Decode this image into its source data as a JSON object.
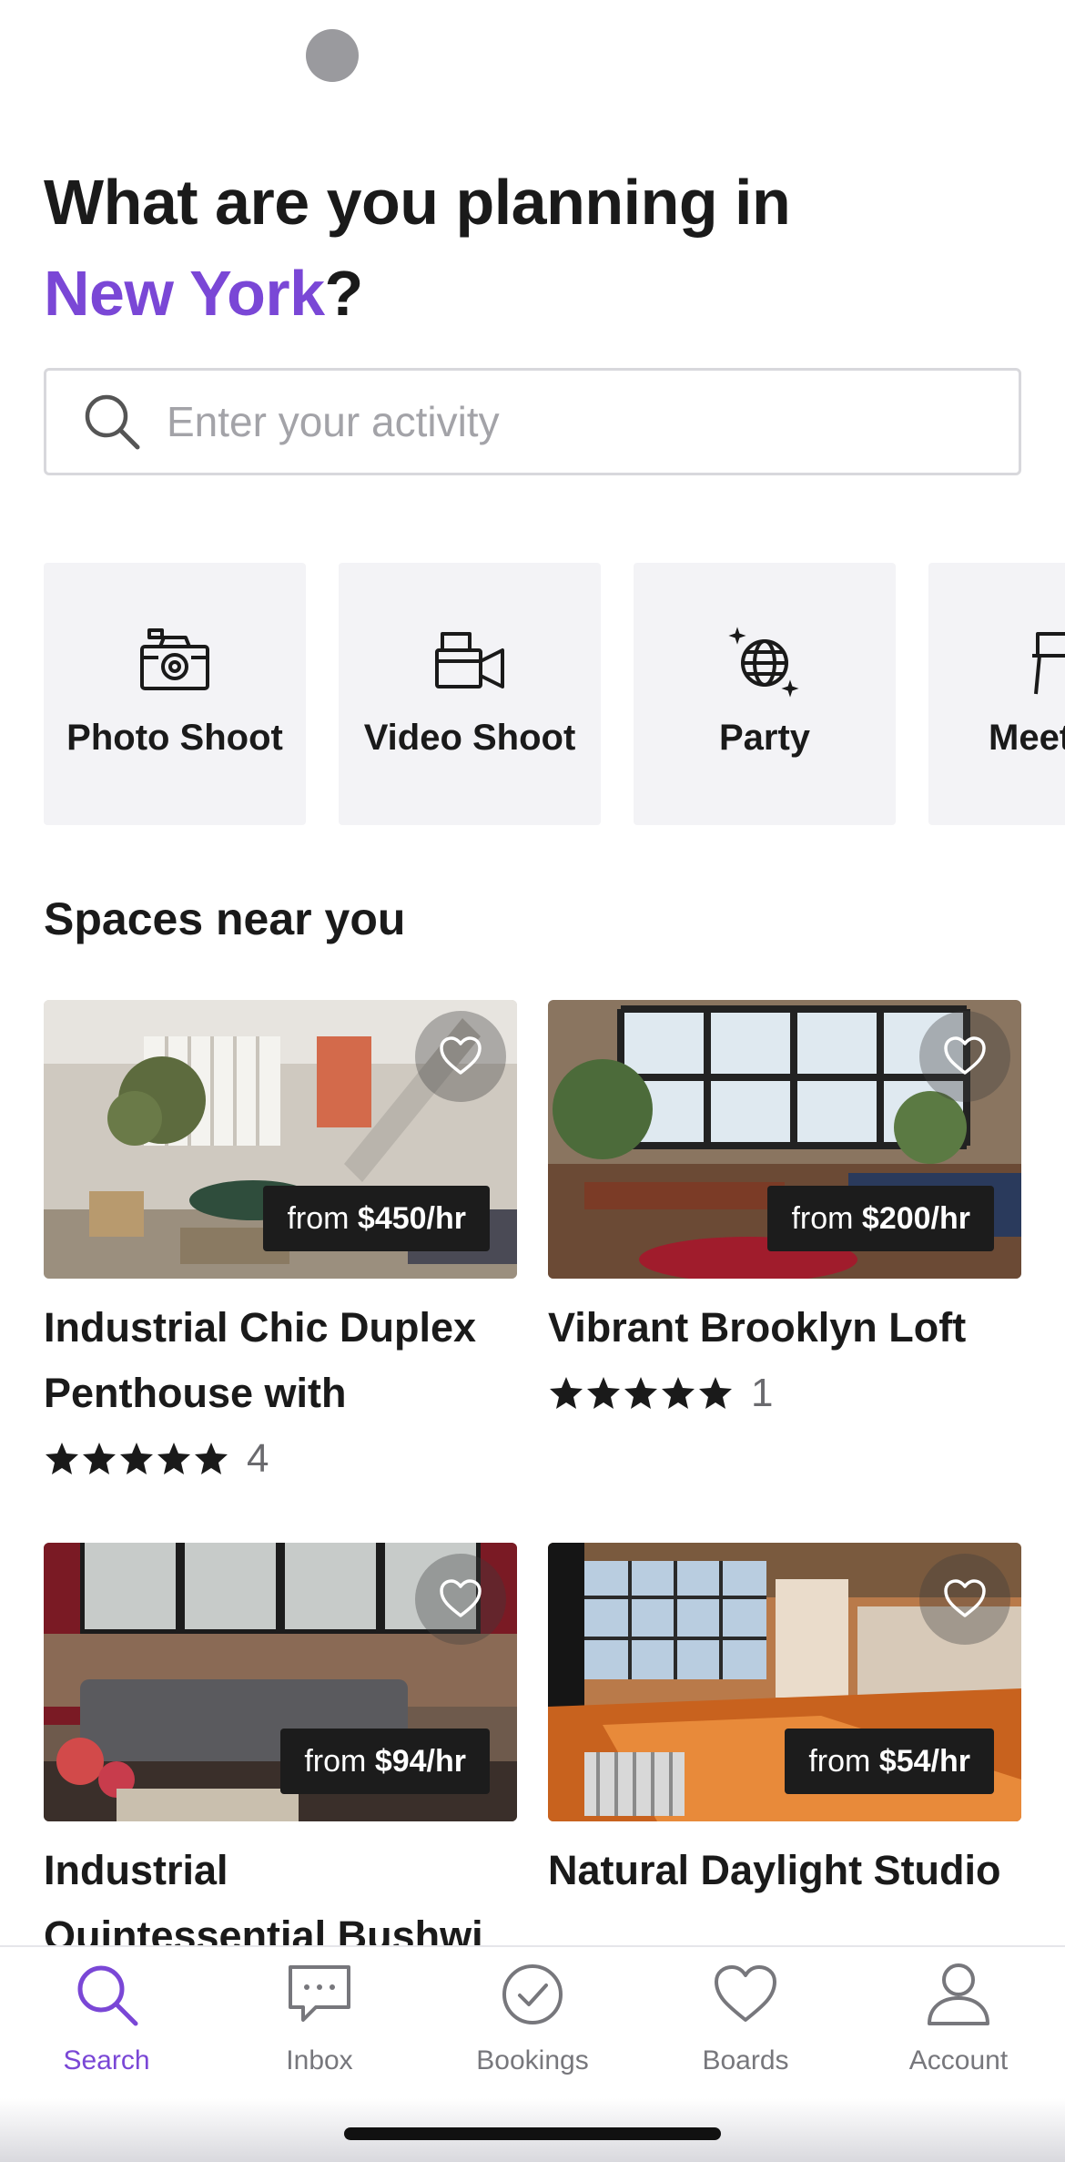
{
  "header": {
    "title_line1": "What are you planning in",
    "city": "New York",
    "title_suffix": "?"
  },
  "search": {
    "placeholder": "Enter your activity",
    "icon": "search-icon"
  },
  "categories": [
    {
      "label": "Photo Shoot",
      "icon": "camera-icon"
    },
    {
      "label": "Video Shoot",
      "icon": "video-camera-icon"
    },
    {
      "label": "Party",
      "icon": "disco-ball-icon"
    },
    {
      "label": "Meet",
      "icon": "chair-icon"
    }
  ],
  "section": {
    "title": "Spaces near you"
  },
  "listings": [
    {
      "title": "Industrial Chic Duplex Penthouse with Abund...",
      "price_prefix": "from ",
      "price": "$450/hr",
      "rating": 5,
      "review_count": "4"
    },
    {
      "title": "Vibrant Brooklyn Loft",
      "price_prefix": "from ",
      "price": "$200/hr",
      "rating": 5,
      "review_count": "1"
    },
    {
      "title": "Industrial Quintessential Bushwi",
      "price_prefix": "from ",
      "price": "$94/hr"
    },
    {
      "title": "Natural Daylight Studio",
      "price_prefix": "from ",
      "price": "$54/hr"
    }
  ],
  "tabbar": {
    "items": [
      {
        "label": "Search",
        "icon": "search-icon",
        "active": true
      },
      {
        "label": "Inbox",
        "icon": "chat-icon",
        "active": false
      },
      {
        "label": "Bookings",
        "icon": "check-circle-icon",
        "active": false
      },
      {
        "label": "Boards",
        "icon": "heart-icon",
        "active": false
      },
      {
        "label": "Account",
        "icon": "person-icon",
        "active": false
      }
    ]
  },
  "colors": {
    "accent": "#7a47d6",
    "text": "#1a1a1a",
    "tile_bg": "#f3f3f6"
  }
}
